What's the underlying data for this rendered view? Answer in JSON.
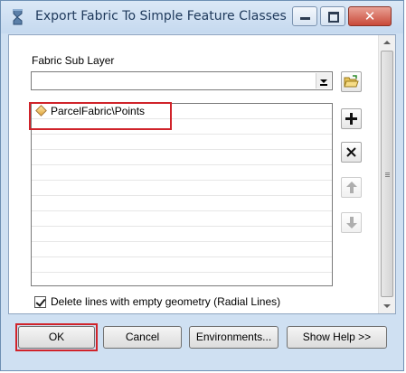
{
  "window": {
    "title": "Export Fabric To Simple Feature Classes"
  },
  "form": {
    "sub_layer_label": "Fabric Sub Layer",
    "sub_layer_value": "",
    "list_items": [
      {
        "label": "ParcelFabric\\Points",
        "icon": "point-feature-icon"
      }
    ],
    "checkbox": {
      "label": "Delete  lines with empty geometry (Radial Lines)",
      "checked": true
    }
  },
  "buttons": {
    "ok": "OK",
    "cancel": "Cancel",
    "environments": "Environments...",
    "show_help": "Show Help >>"
  },
  "colors": {
    "highlight": "#d0232a",
    "titlebar": "#c5d9ef"
  }
}
